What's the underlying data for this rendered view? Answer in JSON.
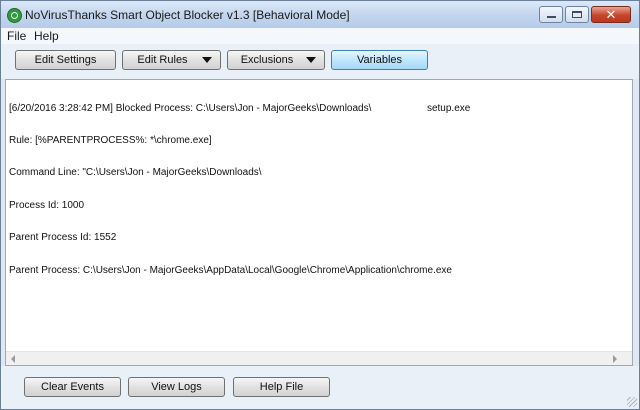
{
  "window": {
    "title": "NoVirusThanks Smart Object Blocker v1.3 [Behavioral Mode]"
  },
  "menu": {
    "file": "File",
    "help": "Help"
  },
  "toolbar": {
    "edit_settings": "Edit Settings",
    "edit_rules": "Edit Rules",
    "exclusions": "Exclusions",
    "variables": "Variables"
  },
  "log": {
    "lines": [
      "[6/20/2016 3:28:42 PM] Blocked Process: C:\\Users\\Jon - MajorGeeks\\Downloads\\                    setup.exe",
      "Rule: [%PARENTPROCESS%: *\\chrome.exe]",
      "Command Line: \"C:\\Users\\Jon - MajorGeeks\\Downloads\\",
      "Process Id: 1000",
      "Parent Process Id: 1552",
      "Parent Process: C:\\Users\\Jon - MajorGeeks\\AppData\\Local\\Google\\Chrome\\Application\\chrome.exe"
    ]
  },
  "bottom": {
    "clear_events": "Clear Events",
    "view_logs": "View Logs",
    "help_file": "Help File"
  }
}
